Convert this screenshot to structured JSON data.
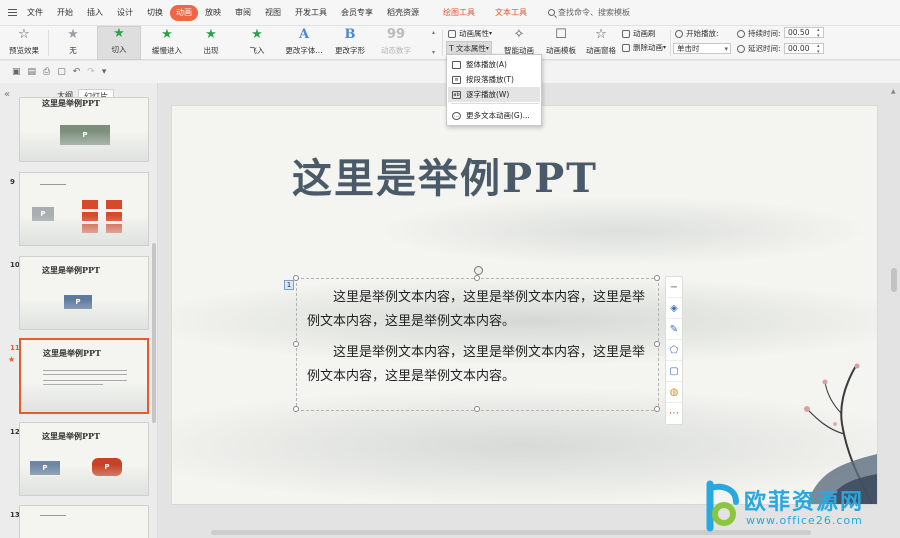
{
  "menu": {
    "file": "文件",
    "items": [
      "开始",
      "插入",
      "设计",
      "切换",
      "动画",
      "放映",
      "审阅",
      "视图",
      "开发工具",
      "会员专享",
      "稻壳资源"
    ],
    "active_index": 4,
    "context_tabs": [
      "绘图工具",
      "文本工具"
    ],
    "search_label": "查找命令、搜索模板"
  },
  "ribbon": {
    "preview": "预览效果",
    "gallery": [
      "无",
      "切入",
      "缓慢进入",
      "出现",
      "飞入",
      "更改字体...",
      "更改字形",
      "动态数字"
    ],
    "gallery_selected": 1,
    "anim_props": "动画属性",
    "text_props": "文本属性",
    "smart_anim": "智能动画",
    "anim_template": "动画模板",
    "anim_pane": "动画窗格",
    "anim_brush": "动画刷",
    "delete_anim": "删除动画",
    "start_play": "开始播放:",
    "start_value": "单击时",
    "duration_label": "持续时间:",
    "duration_value": "00.50",
    "delay_label": "延迟时间:",
    "delay_value": "00.00"
  },
  "dropdown": {
    "items": [
      "整体播放(A)",
      "按段落播放(T)",
      "逐字播放(W)",
      "更多文本动画(G)..."
    ],
    "highlighted": 2
  },
  "panel": {
    "tab_outline": "大纲",
    "tab_slides": "幻灯片"
  },
  "thumbs": [
    {
      "num": "",
      "title": "这里是举例PPT"
    },
    {
      "num": "9",
      "title": ""
    },
    {
      "num": "10",
      "title": "这里是举例PPT"
    },
    {
      "num": "11",
      "title": "这里是举例PPT"
    },
    {
      "num": "12",
      "title": "这里是举例PPT"
    },
    {
      "num": "13",
      "title": ""
    }
  ],
  "slide": {
    "title": "这里是举例PPT",
    "paragraphs": [
      "这里是举例文本内容，这里是举例文本内容，这里是举例文本内容，这里是举例文本内容。",
      "这里是举例文本内容，这里是举例文本内容，这里是举例文本内容，这里是举例文本内容。"
    ],
    "badge": "1"
  },
  "watermark": {
    "text": "欧菲资源网",
    "url": "www.office26.com"
  },
  "colors": {
    "accent": "#ee6644",
    "context_tab": "#e3532f",
    "title": "#4a5a68",
    "watermark": "#29a8e0"
  }
}
